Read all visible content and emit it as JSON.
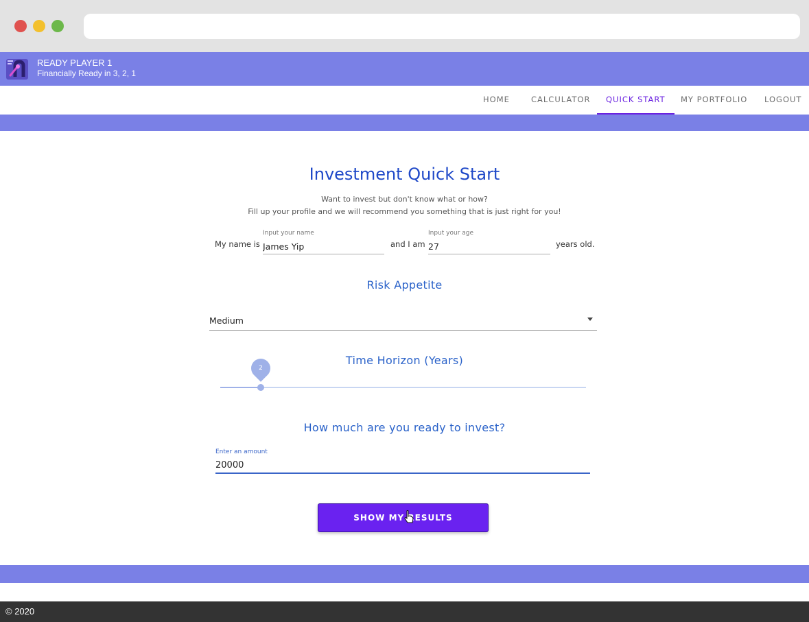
{
  "browser": {
    "window_controls": [
      "close",
      "minimize",
      "maximize"
    ],
    "address_bar": ""
  },
  "app": {
    "title": "READY PLAYER 1",
    "subtitle": "Financially Ready in 3, 2, 1",
    "brand_color": "#7a80e6",
    "accent_color": "#6a22f0"
  },
  "nav": {
    "tabs": [
      {
        "label": "HOME",
        "active": false
      },
      {
        "label": "CALCULATOR",
        "active": false
      },
      {
        "label": "QUICK START",
        "active": true
      },
      {
        "label": "MY PORTFOLIO",
        "active": false
      },
      {
        "label": "LOGOUT",
        "active": false
      }
    ]
  },
  "form": {
    "title": "Investment Quick Start",
    "intro": [
      "Want to invest but don't know what or how?",
      "Fill up your profile and we will recommend you something that is just right for you!"
    ],
    "name_prefix": "My name is",
    "name_label": "Input your name",
    "name_value": "James Yip",
    "age_prefix": "and I am",
    "age_label": "Input your age",
    "age_value": "27",
    "age_suffix": "years old.",
    "risk_heading": "Risk Appetite",
    "risk_value": "Medium",
    "horizon_heading": "Time Horizon (Years)",
    "horizon_value": "2",
    "horizon_fraction": 0.11,
    "amount_heading": "How much are you ready to invest?",
    "amount_label": "Enter an amount",
    "amount_value": "20000",
    "submit_label": "SHOW MY RESULTS"
  },
  "footer": {
    "text": "© 2020"
  }
}
